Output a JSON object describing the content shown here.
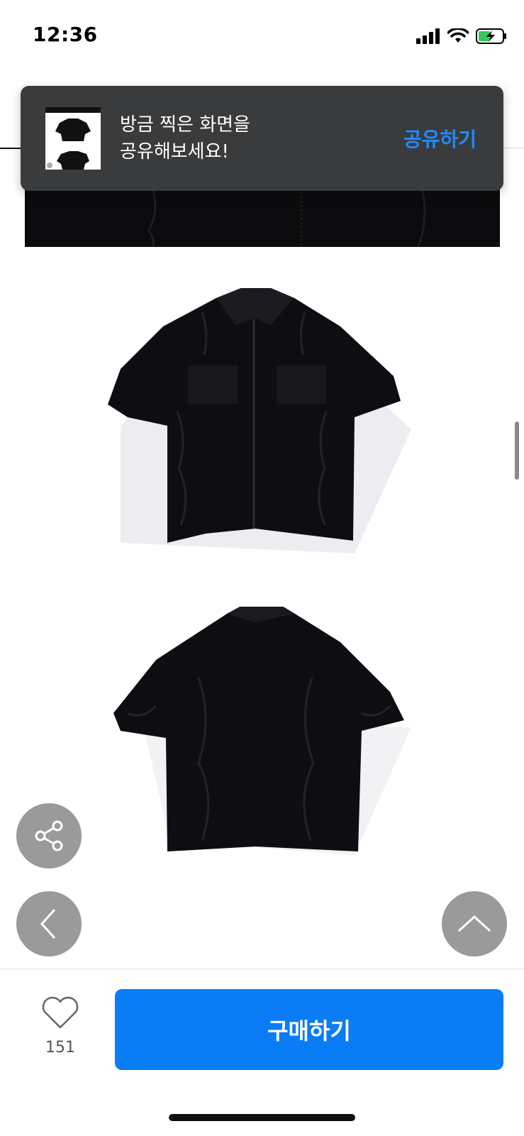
{
  "status_bar": {
    "time": "12:36",
    "icons": [
      "cellular-signal-icon",
      "wifi-icon",
      "battery-charging-icon"
    ]
  },
  "share_toast": {
    "message_line1": "방금 찍은 화면을",
    "message_line2": "공유해보세요!",
    "action_label": "공유하기",
    "action_color": "#1e8bff",
    "thumbnail": "screenshot-thumbnail"
  },
  "product": {
    "images": [
      "jacket-front-image",
      "jacket-back-image"
    ]
  },
  "floating_buttons": {
    "share": "share-icon",
    "back": "chevron-left-icon",
    "top": "chevron-up-icon"
  },
  "bottom_bar": {
    "like_count": "151",
    "buy_label": "구매하기",
    "buy_color": "#0a7cf6"
  }
}
